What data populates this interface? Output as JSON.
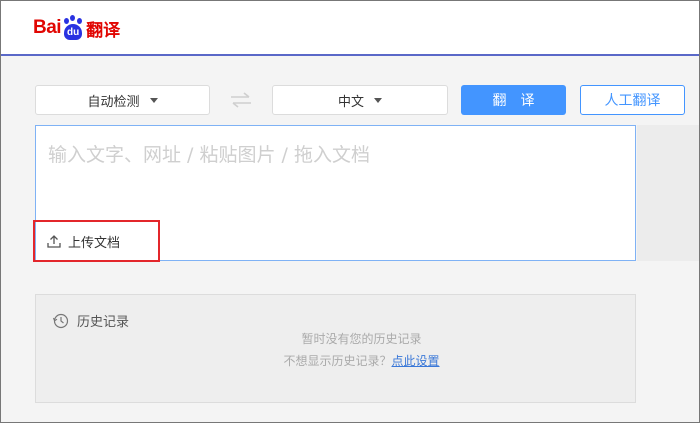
{
  "logo": {
    "text_bai": "Bai",
    "text_du": "du",
    "text_fanyi": "翻译"
  },
  "toolbar": {
    "source_lang": "自动检测",
    "target_lang": "中文",
    "translate_label": "翻译",
    "human_translate_label": "人工翻译"
  },
  "input": {
    "placeholder": "输入文字、网址 / 粘贴图片 / 拖入文档",
    "upload_label": "上传文档"
  },
  "history": {
    "title": "历史记录",
    "empty_message": "暂时没有您的历史记录",
    "hide_prompt": "不想显示历史记录？",
    "settings_link": "点此设置"
  },
  "colors": {
    "brand_red": "#e10602",
    "brand_blue": "#2932e1",
    "accent": "#4395ff",
    "highlight_box": "#e3262b"
  }
}
